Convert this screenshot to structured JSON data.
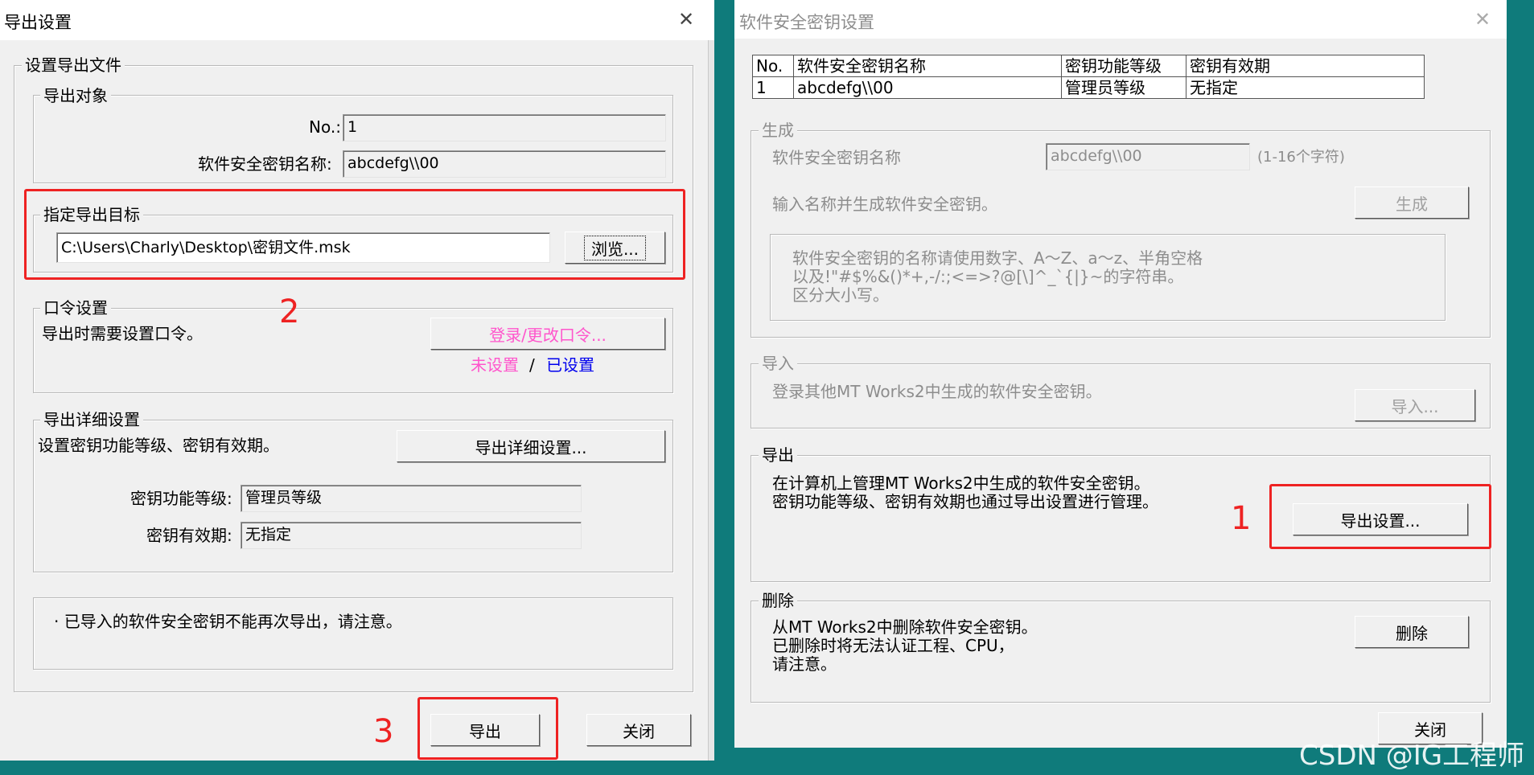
{
  "export_dialog": {
    "title": "导出设置",
    "close_glyph": "✕",
    "group_file": "设置导出文件",
    "group_target_obj": "导出对象",
    "no_label": "No.:",
    "no_value": "1",
    "key_name_label": "软件安全密钥名称:",
    "key_name_value": "abcdefg\\\\00",
    "group_dest": "指定导出目标",
    "dest_path": "C:\\Users\\Charly\\Desktop\\密钥文件.msk",
    "browse_label": "浏览...",
    "group_password": "口令设置",
    "password_desc": "导出时需要设置口令。",
    "password_button": "登录/更改口令...",
    "status_unset": "未设置",
    "status_sep": "/",
    "status_set": "已设置",
    "group_detail": "导出详细设置",
    "detail_desc": "设置密钥功能等级、密钥有效期。",
    "detail_button": "导出详细设置...",
    "level_label": "密钥功能等级:",
    "level_value": "管理员等级",
    "expiry_label": "密钥有效期:",
    "expiry_value": "无指定",
    "note": "· 已导入的软件安全密钥不能再次导出，请注意。",
    "export_button": "导出",
    "close_button": "关闭"
  },
  "key_dialog": {
    "title": "软件安全密钥设置",
    "close_glyph": "✕",
    "table": {
      "headers": [
        "No.",
        "软件安全密钥名称",
        "密钥功能等级",
        "密钥有效期"
      ],
      "rows": [
        [
          "1",
          "abcdefg\\\\00",
          "管理员等级",
          "无指定"
        ]
      ]
    },
    "gen_group": "生成",
    "gen_name_label": "软件安全密钥名称",
    "gen_name_value": "abcdefg\\\\00",
    "gen_name_hint": "(1-16个字符)",
    "gen_desc": "输入名称并生成软件安全密钥。",
    "gen_button": "生成",
    "gen_note_line1": "软件安全密钥的名称请使用数字、A～Z、a～z、半角空格",
    "gen_note_line2": "以及!\"#$%&()*+,-/:;<=>?@[\\]^_`{|}~的字符串。",
    "gen_note_line3": "区分大小写。",
    "import_group": "导入",
    "import_desc": "登录其他MT Works2中生成的软件安全密钥。",
    "import_button": "导入...",
    "export_group": "导出",
    "export_desc_line1": "在计算机上管理MT Works2中生成的软件安全密钥。",
    "export_desc_line2": "密钥功能等级、密钥有效期也通过导出设置进行管理。",
    "export_button": "导出设置...",
    "delete_group": "删除",
    "delete_desc_line1": "从MT Works2中删除软件安全密钥。",
    "delete_desc_line2": "已删除时将无法认证工程、CPU，",
    "delete_desc_line3": "请注意。",
    "delete_button": "删除",
    "close_button": "关闭"
  },
  "annotations": {
    "step1": "1",
    "step2": "2",
    "step3": "3",
    "color": "#ee2222"
  },
  "watermark": "CSDN @IG工程师"
}
